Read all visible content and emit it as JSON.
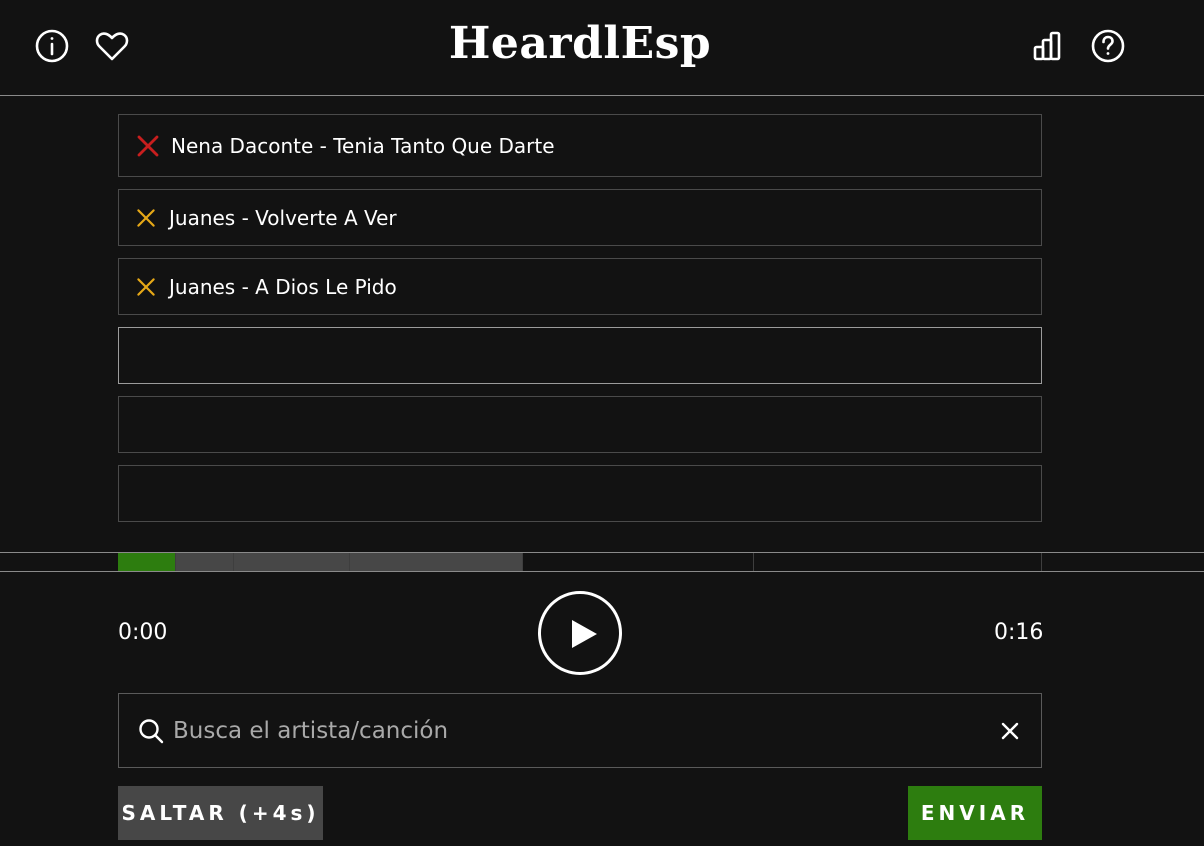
{
  "header": {
    "title": "HeardlEsp",
    "icons": [
      "info-icon",
      "heart-icon",
      "stats-icon",
      "help-icon"
    ]
  },
  "guesses": [
    {
      "text": "Nena Daconte - Tenia Tanto Que Darte",
      "status": "wrong",
      "mark_color": "#c81e1e"
    },
    {
      "text": "Juanes - Volverte A Ver",
      "status": "partial",
      "mark_color": "#e6a817"
    },
    {
      "text": "Juanes - A Dios Le Pido",
      "status": "partial",
      "mark_color": "#e6a817"
    },
    {
      "text": "",
      "status": "current"
    },
    {
      "text": "",
      "status": "empty"
    },
    {
      "text": "",
      "status": "empty"
    }
  ],
  "player": {
    "current_time": "0:00",
    "total_time": "0:16",
    "progress_fraction": 0.0625,
    "unlocked_fraction": 0.4375
  },
  "search": {
    "placeholder": "Busca el artista/canción",
    "value": ""
  },
  "buttons": {
    "skip_label": "SALTAR (+4s)",
    "submit_label": "ENVIAR"
  },
  "colors": {
    "background": "#121212",
    "accent_green": "#2d7d0f",
    "segment_grey": "#474747",
    "skip_button": "#474747",
    "wrong_red": "#c81e1e",
    "partial_yellow": "#e6a817"
  }
}
